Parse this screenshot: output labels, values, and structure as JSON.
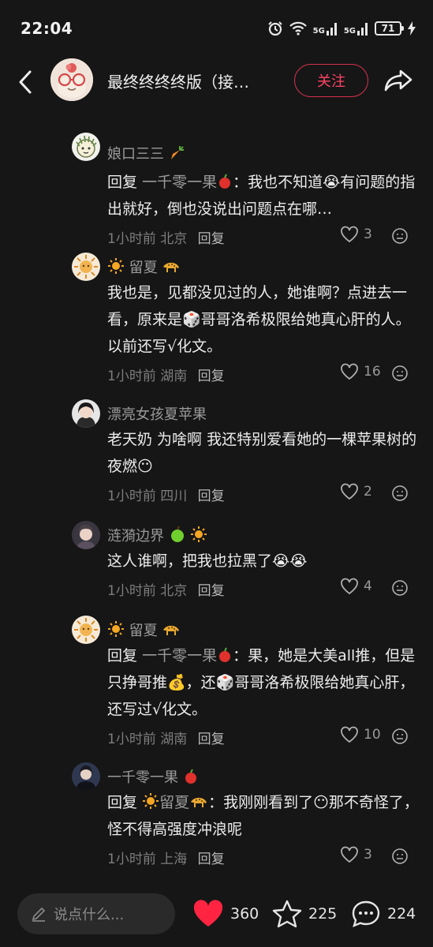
{
  "status": {
    "time": "22:04",
    "network1": "5G",
    "network2": "5G",
    "battery": "71"
  },
  "header": {
    "title": "最终终终终版（接…",
    "follow_label": "关注"
  },
  "comments": [
    {
      "name": "娘口三三",
      "name_emoji": "carrot",
      "reply_word": "回复",
      "reply_target": "一千零一果",
      "text": "：我也不知道😭有问题的指出就好，倒也没说出问题点在哪…",
      "time": "1小时前",
      "location": "北京",
      "reply_label": "回复",
      "likes": "3"
    },
    {
      "name": "留夏",
      "name_emoji": "sun-leopard",
      "reply_word": "",
      "reply_target": "",
      "text": "我也是，见都没见过的人，她谁啊？点进去一看，原来是🎲哥哥洛希极限给她真心肝的人。以前还写√化文。",
      "time": "1小时前",
      "location": "湖南",
      "reply_label": "回复",
      "likes": "16"
    },
    {
      "name": "漂亮女孩夏苹果",
      "name_emoji": "",
      "reply_word": "",
      "reply_target": "",
      "text": "老天奶 为啥啊 我还特别爱看她的一棵苹果树的夜燃😶",
      "time": "1小时前",
      "location": "四川",
      "reply_label": "回复",
      "likes": "2"
    },
    {
      "name": "涟漪边界",
      "name_emoji": "apple-sun",
      "reply_word": "",
      "reply_target": "",
      "text": "这人谁啊，把我也拉黑了😭😭",
      "time": "1小时前",
      "location": "北京",
      "reply_label": "回复",
      "likes": "4"
    },
    {
      "name": "留夏",
      "name_emoji": "sun-leopard",
      "reply_word": "回复",
      "reply_target": "一千零一果",
      "text": "：果，她是大美all推，但是只挣哥推💰，还🎲哥哥洛希极限给她真心肝，还写过√化文。",
      "time": "1小时前",
      "location": "湖南",
      "reply_label": "回复",
      "likes": "10"
    },
    {
      "name": "一千零一果",
      "name_emoji": "apple",
      "reply_word": "回复",
      "reply_target": "留夏",
      "text": "：我刚刚看到了😶那不奇怪了，怪不得高强度冲浪呢",
      "time": "1小时前",
      "location": "上海",
      "reply_label": "回复",
      "likes": "3"
    }
  ],
  "bottom": {
    "placeholder": "说点什么...",
    "likes": "360",
    "stars": "225",
    "comments": "224"
  },
  "colors": {
    "background": "#161616",
    "accent": "#ff2442",
    "muted": "#9a9a9a"
  }
}
